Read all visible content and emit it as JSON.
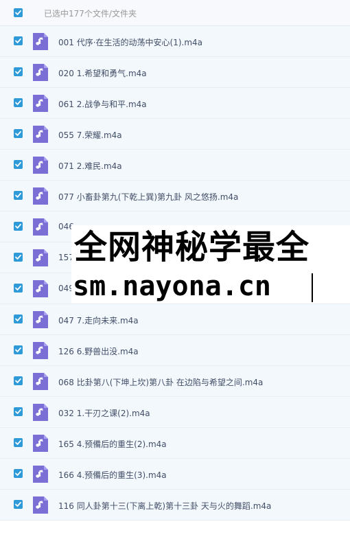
{
  "header": {
    "selection_text": "已选中177个文件/文件夹"
  },
  "files": [
    {
      "name": "001 代序·在生活的动荡中安心(1).m4a"
    },
    {
      "name": "020 1.希望和勇气.m4a"
    },
    {
      "name": "061 2.战争与和平.m4a"
    },
    {
      "name": "055 7.荣耀.m4a"
    },
    {
      "name": "071 2.难民.m4a"
    },
    {
      "name": "077 小畜卦第九(下乾上巽)第九卦 风之悠扬.m4a"
    },
    {
      "name": "046"
    },
    {
      "name": "157"
    },
    {
      "name": "049"
    },
    {
      "name": "047 7.走向未来.m4a"
    },
    {
      "name": "126 6.野兽出没.m4a"
    },
    {
      "name": "068 比卦第八(下坤上坎)第八卦 在边陷与希望之间.m4a"
    },
    {
      "name": "032 1.干刃之课(2).m4a"
    },
    {
      "name": "165 4.预備后的重生(2).m4a"
    },
    {
      "name": "166 4.预備后的重生(3).m4a"
    },
    {
      "name": "116 同人卦第十三(下离上乾)第十三卦 天与火的舞蹈.m4a"
    }
  ],
  "watermark": {
    "line1": "全网神秘学最全",
    "line2": "sm.nayona.cn"
  },
  "colors": {
    "checkbox": "#2f9ad8",
    "file_icon": "#7b6fd6",
    "row_background": "#f3f8fd"
  }
}
